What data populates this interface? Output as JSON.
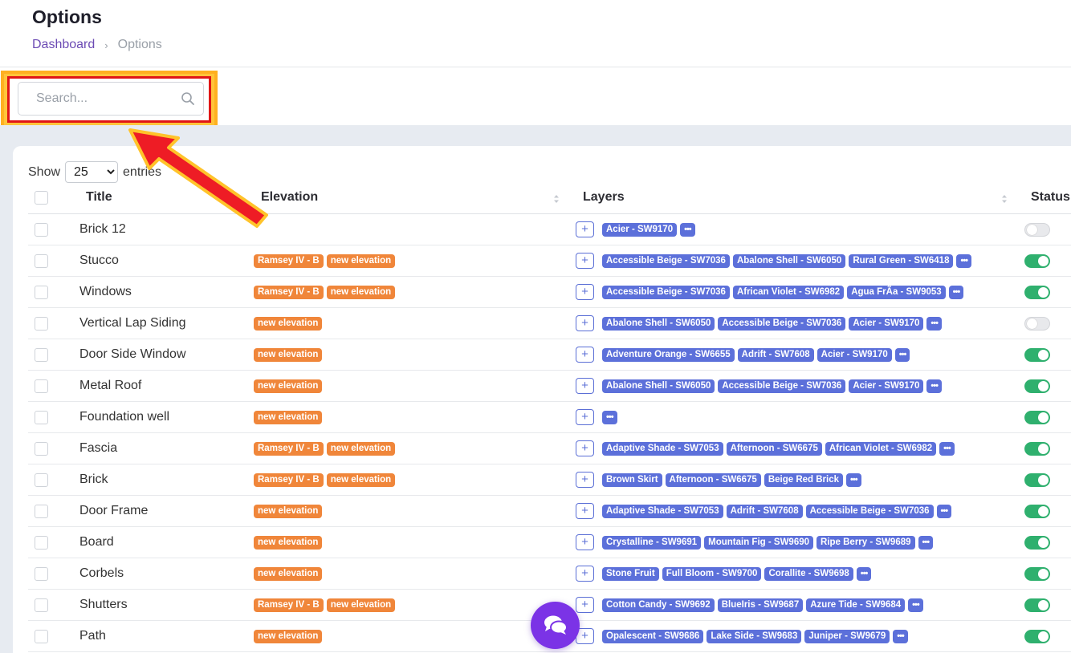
{
  "header": {
    "title": "Options",
    "breadcrumb": {
      "home": "Dashboard",
      "separator": "›",
      "current": "Options"
    }
  },
  "search": {
    "placeholder": "Search...",
    "value": ""
  },
  "table_controls": {
    "show_label": "Show",
    "entries_value": "25",
    "entries_label": "entries"
  },
  "columns": {
    "title": "Title",
    "elevation": "Elevation",
    "layers": "Layers",
    "status": "Status"
  },
  "add_layer_symbol": "+",
  "more_symbol": "•••",
  "rows": [
    {
      "title": "Brick 12",
      "elevations": [],
      "layers": [
        "Acier - SW9170"
      ],
      "status": "off"
    },
    {
      "title": "Stucco",
      "elevations": [
        "Ramsey IV - B",
        "new elevation"
      ],
      "layers": [
        "Accessible Beige - SW7036",
        "Abalone Shell - SW6050",
        "Rural Green - SW6418"
      ],
      "status": "on"
    },
    {
      "title": "Windows",
      "elevations": [
        "Ramsey IV - B",
        "new elevation"
      ],
      "layers": [
        "Accessible Beige - SW7036",
        "African Violet - SW6982",
        "Agua FrÃa - SW9053"
      ],
      "status": "on"
    },
    {
      "title": "Vertical Lap Siding",
      "elevations": [
        "new elevation"
      ],
      "layers": [
        "Abalone Shell - SW6050",
        "Accessible Beige - SW7036",
        "Acier - SW9170"
      ],
      "status": "off"
    },
    {
      "title": "Door Side Window",
      "elevations": [
        "new elevation"
      ],
      "layers": [
        "Adventure Orange - SW6655",
        "Adrift - SW7608",
        "Acier - SW9170"
      ],
      "status": "on"
    },
    {
      "title": "Metal Roof",
      "elevations": [
        "new elevation"
      ],
      "layers": [
        "Abalone Shell - SW6050",
        "Accessible Beige - SW7036",
        "Acier - SW9170"
      ],
      "status": "on"
    },
    {
      "title": "Foundation well",
      "elevations": [
        "new elevation"
      ],
      "layers": [],
      "status": "on"
    },
    {
      "title": "Fascia",
      "elevations": [
        "Ramsey IV - B",
        "new elevation"
      ],
      "layers": [
        "Adaptive Shade - SW7053",
        "Afternoon - SW6675",
        "African Violet - SW6982"
      ],
      "status": "on"
    },
    {
      "title": "Brick",
      "elevations": [
        "Ramsey IV - B",
        "new elevation"
      ],
      "layers": [
        "Brown Skirt",
        "Afternoon - SW6675",
        "Beige Red Brick"
      ],
      "status": "on"
    },
    {
      "title": "Door Frame",
      "elevations": [
        "new elevation"
      ],
      "layers": [
        "Adaptive Shade - SW7053",
        "Adrift - SW7608",
        "Accessible Beige - SW7036"
      ],
      "status": "on"
    },
    {
      "title": "Board",
      "elevations": [
        "new elevation"
      ],
      "layers": [
        "Crystalline - SW9691",
        "Mountain Fig - SW9690",
        "Ripe Berry - SW9689"
      ],
      "status": "on"
    },
    {
      "title": "Corbels",
      "elevations": [
        "new elevation"
      ],
      "layers": [
        "Stone Fruit",
        "Full Bloom - SW9700",
        "Corallite - SW9698"
      ],
      "status": "on"
    },
    {
      "title": "Shutters",
      "elevations": [
        "Ramsey IV - B",
        "new elevation"
      ],
      "layers": [
        "Cotton Candy - SW9692",
        "BlueIris - SW9687",
        "Azure Tide - SW9684"
      ],
      "status": "on"
    },
    {
      "title": "Path",
      "elevations": [
        "new elevation"
      ],
      "layers": [
        "Opalescent - SW9686",
        "Lake Side - SW9683",
        "Juniper - SW9679"
      ],
      "status": "on"
    }
  ],
  "colors": {
    "elevation_badge": "#f0863a",
    "layer_badge": "#5c70da",
    "toggle_on": "#2fb06e",
    "chat_button": "#7b33e6",
    "highlight_border": "#e01515",
    "arrow": "#ee1c25"
  },
  "icons": {
    "search": "search-icon",
    "chat": "chat-bubbles-icon",
    "annotation": "red-arrow-icon"
  }
}
